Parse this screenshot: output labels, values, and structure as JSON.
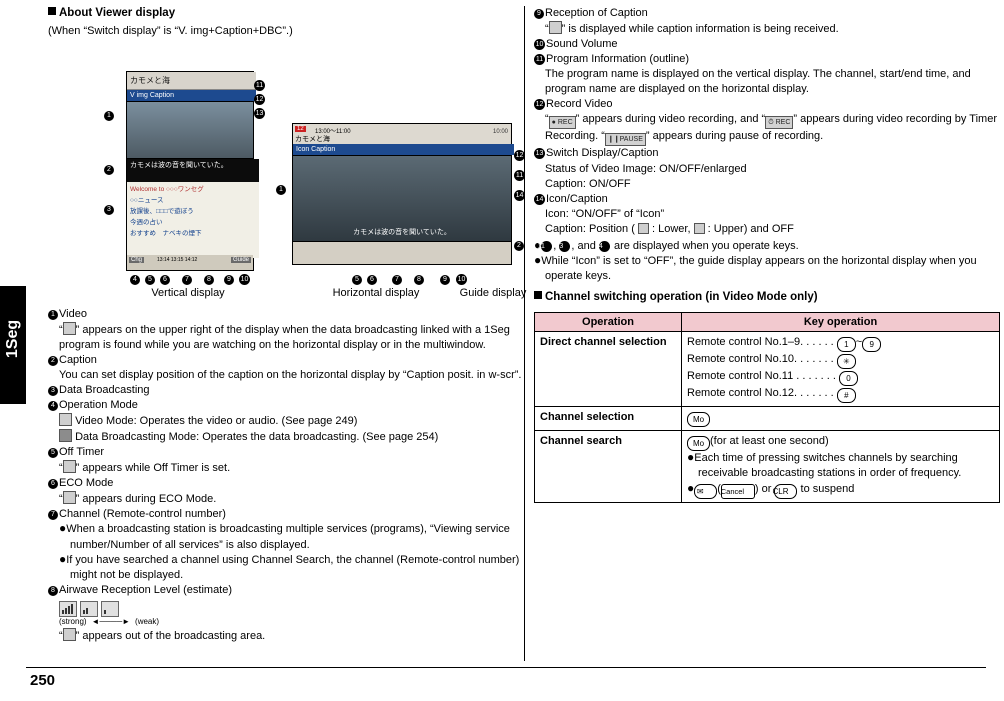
{
  "page": {
    "number": "250",
    "side_tab": "1Seg"
  },
  "left": {
    "heading": "About Viewer display",
    "subheading": "(When “Switch display” is “V. img+Caption+DBC”.)",
    "figure": {
      "vertical_caption": "Vertical display",
      "horizontal_caption": "Horizontal display",
      "guide_caption": "Guide display",
      "vertical_screen": {
        "title_bar": "カモメと海",
        "mode_bar": "V img   Caption",
        "caption_text": "カモメは波の音を聞いていた。",
        "dbc_lines": [
          "Welcome to ○○○ワンセグ",
          "○○ニュース",
          "放課後、□□□で遊ぼう",
          "今週の占い",
          "おすすめ　ナベキの煙下"
        ],
        "soft_keys": [
          "Chg",
          "13:14 13:15 14:12",
          "Guide"
        ]
      },
      "horizontal_screen": {
        "time_range": "13:00～11:00",
        "title": "カモメと海",
        "mode_bar": "Icon    Caption",
        "clock": "10:00",
        "caption_text": "カモメは波の音を聞いていた。"
      }
    },
    "items": [
      {
        "num": "1",
        "title": "Video",
        "lines": [
          "“ ” appears on the upper right of the display when the data broadcasting linked with a 1Seg program is found while you are watching on the horizontal display or in the multiwindow."
        ]
      },
      {
        "num": "2",
        "title": "Caption",
        "lines": [
          "You can set display position of the caption on the horizontal display by “Caption posit. in w-scr”."
        ]
      },
      {
        "num": "3",
        "title": "Data Broadcasting",
        "lines": []
      },
      {
        "num": "4",
        "title": "Operation Mode",
        "lines": [
          "Video Mode: Operates the video or audio. (See page 249)",
          "Data Broadcasting Mode: Operates the data broadcasting. (See page 254)"
        ]
      },
      {
        "num": "5",
        "title": "Off Timer",
        "lines": [
          "“ ” appears while Off Timer is set."
        ]
      },
      {
        "num": "6",
        "title": "ECO Mode",
        "lines": [
          "“ ” appears during ECO Mode."
        ]
      },
      {
        "num": "7",
        "title": "Channel (Remote-control number)",
        "bullets": [
          "When a broadcasting station is broadcasting multiple services (programs), “Viewing service number/Number of all services” is also displayed.",
          "If you have searched a channel using Channel Search, the channel (Remote-control number) might not be displayed."
        ]
      },
      {
        "num": "8",
        "title": "Airwave Reception Level (estimate)",
        "strong_label": "(strong)",
        "weak_label": "(weak)",
        "lines": [
          "“ ” appears out of the broadcasting area."
        ]
      }
    ]
  },
  "right": {
    "items": [
      {
        "num": "9",
        "title": "Reception of Caption",
        "lines": [
          "“ ” is displayed while caption information is being received."
        ]
      },
      {
        "num": "10",
        "title": "Sound Volume",
        "lines": []
      },
      {
        "num": "11",
        "title": "Program Information (outline)",
        "lines": [
          "The program name is displayed on the vertical display. The channel, start/end time, and program name are displayed on the horizontal display."
        ]
      },
      {
        "num": "12",
        "title": "Record Video",
        "lines": [
          "“ ” appears during video recording, and “ ” appears during video recording by Timer Recording. “ ” appears during pause of recording."
        ]
      },
      {
        "num": "13",
        "title": "Switch Display/Caption",
        "lines": [
          "Status of Video Image: ON/OFF/enlarged",
          "Caption: ON/OFF"
        ]
      },
      {
        "num": "14",
        "title": "Icon/Caption",
        "lines": [
          "Icon: “ON/OFF” of “Icon”",
          "Caption: Position ( : Lower,  : Upper) and OFF"
        ]
      }
    ],
    "notes": [
      ", , and  are displayed when you operate keys.",
      "While “Icon” is set to “OFF”, the guide display appears on the horizontal display when you operate keys."
    ],
    "table_heading": "Channel switching operation (in Video Mode only)",
    "table": {
      "headers": [
        "Operation",
        "Key operation"
      ],
      "rows": [
        {
          "operation": "Direct channel selection",
          "lines": [
            {
              "text": "Remote control No.1–9. . . . . .",
              "keys": [
                "1",
                "9"
              ],
              "sep": "~"
            },
            {
              "text": "Remote control No.10. . . . . . .",
              "keys": [
                "✳"
              ]
            },
            {
              "text": "Remote control No.11 . . . . . . .",
              "keys": [
                "0"
              ]
            },
            {
              "text": "Remote control No.12. . . . . . .",
              "keys": [
                "#"
              ]
            }
          ]
        },
        {
          "operation": "Channel selection",
          "key": "Mo"
        },
        {
          "operation": "Channel search",
          "key": "Mo",
          "suffix": "(for at least one second)",
          "bullets": [
            "Each time of pressing switches channels by searching receivable broadcasting stations in order of frequency.",
            " ( ) or  to suspend"
          ],
          "cancel_label": "Cancel",
          "clr_label": "CLR"
        }
      ]
    }
  }
}
